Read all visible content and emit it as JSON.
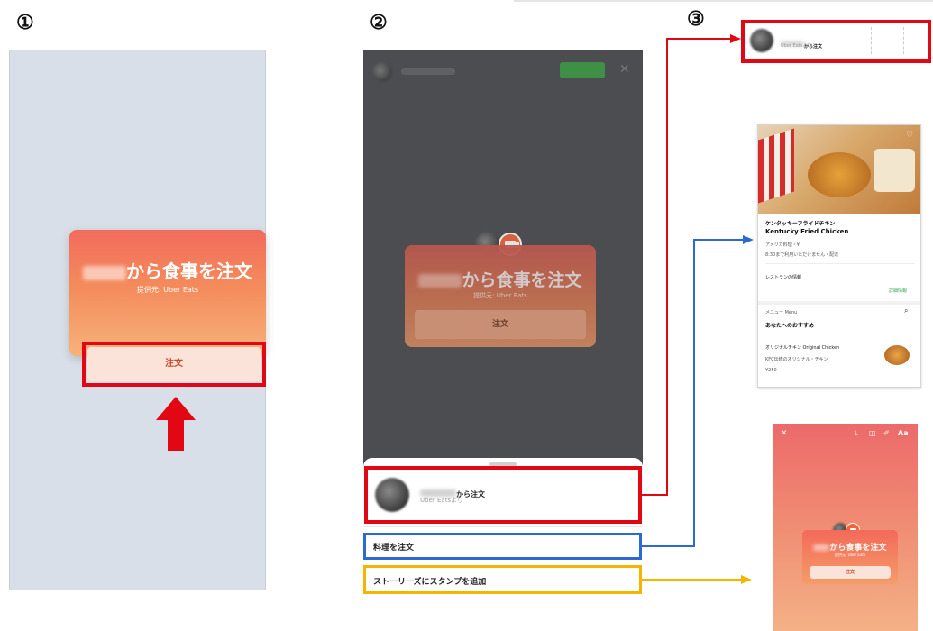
{
  "steps": {
    "one": "①",
    "two": "②",
    "three": "③"
  },
  "sticker": {
    "blurred_name": "",
    "title_suffix": "から食事を注文",
    "provider": "提供元: Uber Eats",
    "order_label": "注文"
  },
  "panel2_header": {
    "badge": ""
  },
  "sheet": {
    "order_from_suffix": "から注文",
    "order_from_sub": "Uber Eatsより",
    "order_food": "料理を注文",
    "add_story": "ストーリーズにスタンプを追加"
  },
  "top_card": {
    "title_suffix": "から注文",
    "sub": "Uber Eatsより"
  },
  "kfc_screen": {
    "name_jp": "ケンタッキーフライドチキン",
    "name_en": "Kentucky Fried Chicken",
    "category": "アメリカ料理・¥",
    "delivery": "8:30まで利用いただけません・配達",
    "info": "レストランの情報",
    "info_link": "詳細情報",
    "menu": "メニュー Menu",
    "recommend": "あなたへのおすすめ",
    "item_name": "オリジナルチキン Original Chicken",
    "item_desc": "KFC伝統のオリジナル・チキン",
    "item_price": "¥250"
  },
  "story_screen": {
    "title": "から食事を注文",
    "sub": "提供元: Uber Eats",
    "order": "注文",
    "aa": "Aa"
  },
  "colors": {
    "red": "#e30613",
    "blue": "#2b6ad6",
    "yellow": "#f4b400",
    "orange": "#f0643c"
  }
}
